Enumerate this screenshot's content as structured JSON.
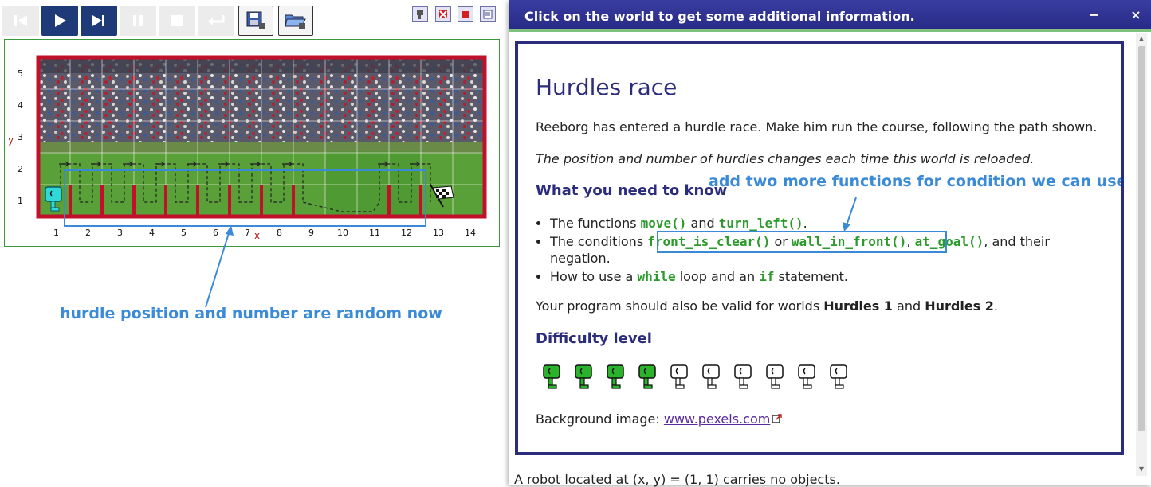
{
  "toolbar": {
    "buttons": [
      {
        "name": "reverse-step-button",
        "state": "disabled"
      },
      {
        "name": "run-button",
        "state": "active"
      },
      {
        "name": "step-button",
        "state": "active"
      },
      {
        "name": "pause-button",
        "state": "disabled"
      },
      {
        "name": "stop-button",
        "state": "disabled"
      },
      {
        "name": "reload-button",
        "state": "disabled"
      },
      {
        "name": "save-button",
        "state": "file"
      },
      {
        "name": "open-button",
        "state": "file"
      }
    ],
    "mini_icons": [
      "robot-settings-icon",
      "delete-icon",
      "flag-icon",
      "list-icon"
    ]
  },
  "world": {
    "x_axis_label": "x",
    "y_axis_label": "y",
    "x_ticks": [
      "1",
      "2",
      "3",
      "4",
      "5",
      "6",
      "7",
      "8",
      "9",
      "10",
      "11",
      "12",
      "13",
      "14"
    ],
    "y_ticks": [
      "1",
      "2",
      "3",
      "4",
      "5"
    ],
    "robot_position": {
      "x": 1,
      "y": 1
    },
    "goal_position": {
      "x": 13,
      "y": 1
    },
    "hurdle_after_columns": [
      1,
      2,
      3,
      4,
      5,
      6,
      7,
      8,
      11,
      12
    ]
  },
  "annotations": {
    "bottom": "hurdle position and number are random now",
    "top": "add two more functions for condition we can use"
  },
  "dialog": {
    "title": "Click on the world to get some additional information.",
    "minimize": "−",
    "close": "×",
    "heading": "Hurdles race",
    "intro": "Reeborg has entered a hurdle race. Make him run the course, following the path shown.",
    "note": "The position and number of hurdles changes each time this world is reloaded.",
    "need_heading": "What you need to know",
    "bullets": {
      "b1_pre": "The functions ",
      "b1_f1": "move()",
      "b1_mid": " and ",
      "b1_f2": "turn_left()",
      "b1_post": ".",
      "b2_pre": "The conditions ",
      "b2_f1": "front_is_clear()",
      "b2_mid1": " or ",
      "b2_f2": "wall_in_front()",
      "b2_mid2": ", ",
      "b2_f3": "at_goal()",
      "b2_post": ", and their negation.",
      "b3_pre": "How to use a ",
      "b3_f1": "while",
      "b3_mid": " loop and an ",
      "b3_f2": "if",
      "b3_post": " statement."
    },
    "valid_pre": "Your program should also be valid for worlds ",
    "valid_w1": "Hurdles 1",
    "valid_mid": " and ",
    "valid_w2": "Hurdles 2",
    "valid_post": ".",
    "difficulty_heading": "Difficulty level",
    "difficulty": {
      "level": 4,
      "max": 10
    },
    "bg_label": "Background image: ",
    "bg_link": "www.pexels.com",
    "footer": "A robot located at (x, y) = (1, 1) carries no objects."
  },
  "colors": {
    "titlebar": "#2c2e8e",
    "accent_green": "#2a9a2a",
    "annotation_blue": "#3a8ad8",
    "wall_red": "#c0102a",
    "heading_navy": "#2c2c7c"
  }
}
